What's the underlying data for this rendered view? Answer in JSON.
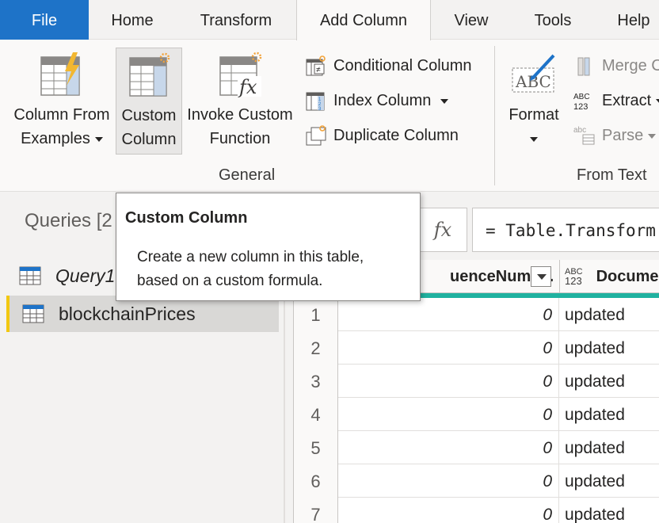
{
  "tabs": [
    {
      "label": "File"
    },
    {
      "label": "Home"
    },
    {
      "label": "Transform"
    },
    {
      "label": "Add Column"
    },
    {
      "label": "View"
    },
    {
      "label": "Tools"
    },
    {
      "label": "Help"
    }
  ],
  "ribbon": {
    "general": {
      "group_label": "General",
      "column_from_examples": {
        "line1": "Column From",
        "line2": "Examples"
      },
      "custom_column": {
        "line1": "Custom",
        "line2": "Column"
      },
      "invoke_custom_function": {
        "line1": "Invoke Custom",
        "line2": "Function"
      },
      "conditional_column": "Conditional Column",
      "index_column": "Index Column",
      "duplicate_column": "Duplicate Column"
    },
    "from_text": {
      "group_label": "From Text",
      "format": "Format",
      "merge_columns": "Merge C",
      "extract": "Extract",
      "parse": "Parse",
      "abc_glyph": "ABC",
      "abc_123_glyph": "ABC\n123",
      "abc_small": "abc"
    }
  },
  "tooltip": {
    "title": "Custom Column",
    "body": "Create a new column in this table, based on a custom formula."
  },
  "queries": {
    "title": "Queries [2",
    "items": [
      {
        "label": "Query1"
      },
      {
        "label": "blockchainPrices"
      }
    ]
  },
  "formula_bar": {
    "fx": "fx",
    "text": "= Table.Transform"
  },
  "grid": {
    "columns": [
      {
        "header": "uenceNumb..."
      },
      {
        "header": "Docume",
        "type_top": "ABC",
        "type_bottom": "123"
      }
    ],
    "rows": [
      {
        "n": "1",
        "seq": "0",
        "doc": "updated"
      },
      {
        "n": "2",
        "seq": "0",
        "doc": "updated"
      },
      {
        "n": "3",
        "seq": "0",
        "doc": "updated"
      },
      {
        "n": "4",
        "seq": "0",
        "doc": "updated"
      },
      {
        "n": "5",
        "seq": "0",
        "doc": "updated"
      },
      {
        "n": "6",
        "seq": "0",
        "doc": "updated"
      },
      {
        "n": "7",
        "seq": "0",
        "doc": "updated"
      }
    ]
  },
  "colors": {
    "file_tab": "#1e73c8",
    "accent_teal": "#20b2a0",
    "selected_query_bar": "#f2c811"
  }
}
